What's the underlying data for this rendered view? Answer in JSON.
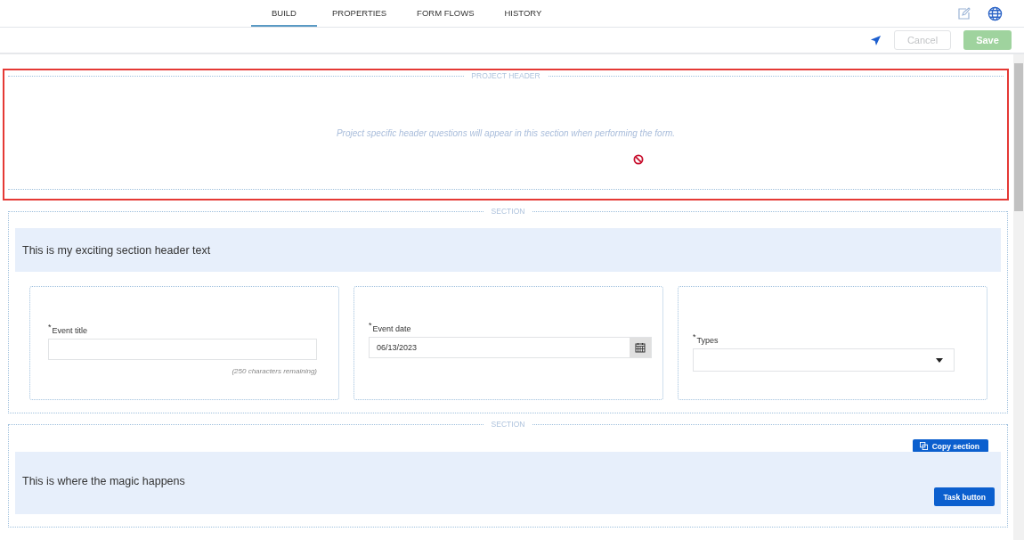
{
  "tabs": [
    {
      "label": "BUILD",
      "selected": true
    },
    {
      "label": "PROPERTIES",
      "selected": false
    },
    {
      "label": "FORM FLOWS",
      "selected": false
    },
    {
      "label": "HISTORY",
      "selected": false
    }
  ],
  "toolbar": {
    "cancel": "Cancel",
    "save": "Save",
    "cancel_disabled": true
  },
  "project_header": {
    "title": "PROJECT HEADER",
    "message": "Project specific header questions will appear in this section when performing the form.",
    "highlighted": true
  },
  "sections": [
    {
      "title": "SECTION",
      "header": "This is my exciting section header text",
      "fields": [
        {
          "kind": "text",
          "required": "*",
          "label": "Event title",
          "hint": "(250 characters remaining)"
        },
        {
          "kind": "date",
          "required": "*",
          "label": "Event date",
          "value": "06/13/2023"
        },
        {
          "kind": "select",
          "required": "*",
          "label": "Types"
        }
      ]
    },
    {
      "title": "SECTION",
      "header": "This is where the magic happens",
      "buttons": [
        {
          "kind": "copy",
          "label": "Copy section"
        },
        {
          "kind": "task",
          "label": "Task button"
        }
      ]
    }
  ]
}
